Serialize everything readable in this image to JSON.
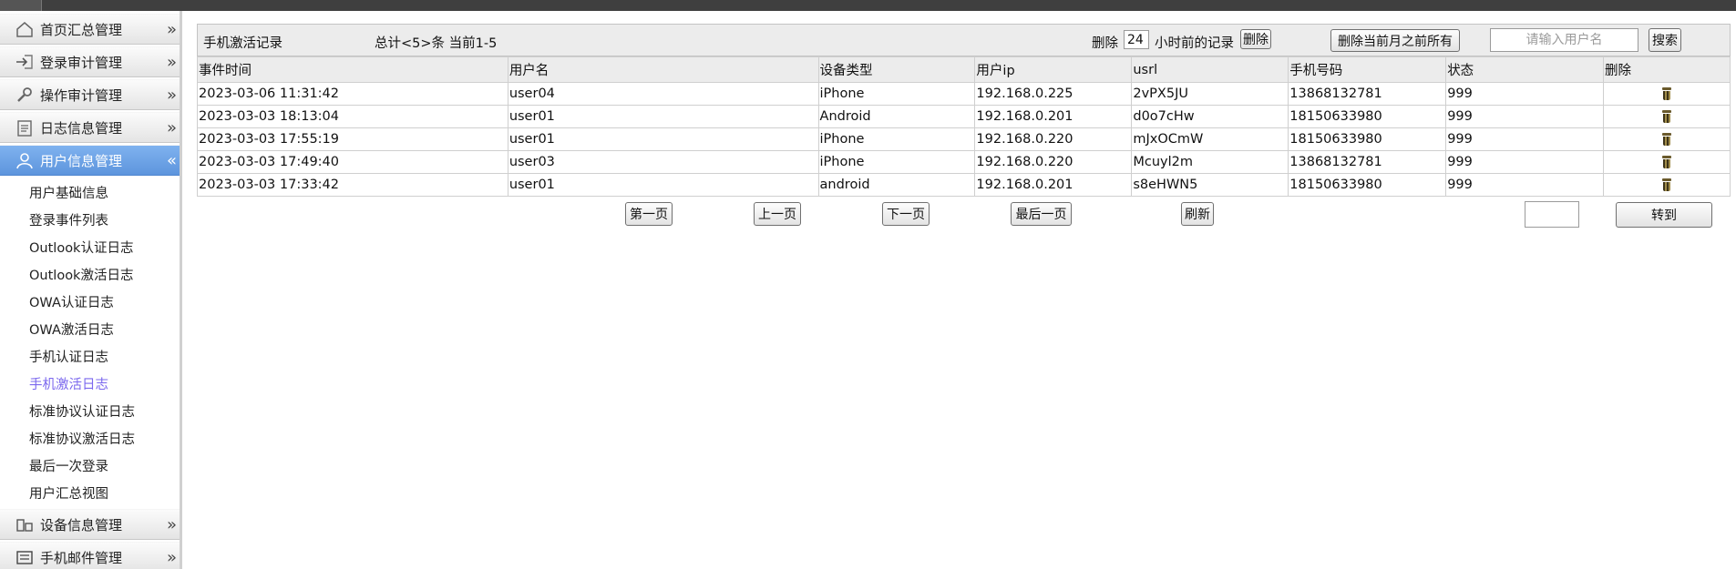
{
  "sidebar": {
    "groups": [
      {
        "label": "首页汇总管理",
        "icon": "home-icon"
      },
      {
        "label": "登录审计管理",
        "icon": "login-icon"
      },
      {
        "label": "操作审计管理",
        "icon": "wrench-icon"
      },
      {
        "label": "日志信息管理",
        "icon": "clipboard-icon"
      },
      {
        "label": "用户信息管理",
        "icon": "user-icon"
      },
      {
        "label": "设备信息管理",
        "icon": "device-icon"
      },
      {
        "label": "手机邮件管理",
        "icon": "mail-icon"
      }
    ],
    "expand_arrow": "»",
    "collapse_arrow": "«",
    "sub_items": [
      "用户基础信息",
      "登录事件列表",
      "Outlook认证日志",
      "Outlook激活日志",
      "OWA认证日志",
      "OWA激活日志",
      "手机认证日志",
      "手机激活日志",
      "标准协议认证日志",
      "标准协议激活日志",
      "最后一次登录",
      "用户汇总视图"
    ],
    "current_sub_item": "手机激活日志",
    "colors": {
      "active_group": "#6ea3e6",
      "current_sub_item": "#7b68ee"
    }
  },
  "toolbar": {
    "title": "手机激活记录",
    "summary": "总计<5>条 当前1-5",
    "delete_prefix": "删除",
    "hours_value": "24",
    "delete_suffix": "小时前的记录",
    "delete_button": "删除",
    "delete_before_month_button": "删除当前月之前所有",
    "search_placeholder": "请输入用户名",
    "search_button": "搜索"
  },
  "table": {
    "columns": [
      "事件时间",
      "用户名",
      "设备类型",
      "用户ip",
      "usrl",
      "手机号码",
      "状态",
      "删除"
    ],
    "rows": [
      [
        "2023-03-06 11:31:42",
        "user04",
        "iPhone",
        "192.168.0.225",
        "2vPX5JU",
        "13868132781",
        "999"
      ],
      [
        "2023-03-03 18:13:04",
        "user01",
        "Android",
        "192.168.0.201",
        "d0o7cHw",
        "18150633980",
        "999"
      ],
      [
        "2023-03-03 17:55:19",
        "user01",
        "iPhone",
        "192.168.0.220",
        "mJxOCmW",
        "18150633980",
        "999"
      ],
      [
        "2023-03-03 17:49:40",
        "user03",
        "iPhone",
        "192.168.0.220",
        "Mcuyl2m",
        "13868132781",
        "999"
      ],
      [
        "2023-03-03 17:33:42",
        "user01",
        "android",
        "192.168.0.201",
        "s8eHWN5",
        "18150633980",
        "999"
      ]
    ],
    "delete_icon": "trash-icon"
  },
  "pager": {
    "first": "第一页",
    "prev": "上一页",
    "next": "下一页",
    "last": "最后一页",
    "refresh": "刷新",
    "page_value": "",
    "goto": "转到"
  }
}
